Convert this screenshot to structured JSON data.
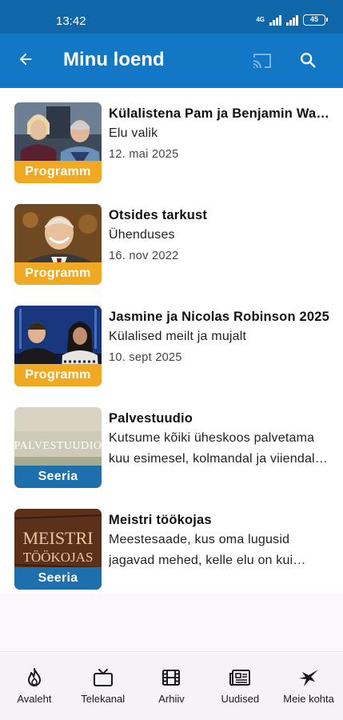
{
  "status_bar": {
    "time": "13:42",
    "network": "4G",
    "battery": "45"
  },
  "app_bar": {
    "title": "Minu loend"
  },
  "colors": {
    "app_bar": "#1277c4",
    "status_bar": "#0f66a8",
    "program_badge": "#f2a922",
    "series_badge": "#1d6fae"
  },
  "items": [
    {
      "badge": "Programm",
      "title": "Külalistena Pam ja Benjamin Wagner",
      "subtitle": "Elu valik",
      "date": "12. mai 2025"
    },
    {
      "badge": "Programm",
      "title": "Otsides tarkust",
      "subtitle": "Ühenduses",
      "date": "16. nov 2022"
    },
    {
      "badge": "Programm",
      "title": "Jasmine ja Nicolas Robinson 2025",
      "subtitle": "Külalised meilt ja mujalt",
      "date": "10. sept 2025"
    },
    {
      "badge": "Seeria",
      "title": "Palvestuudio",
      "description": "Kutsume kõiki üheskoos palvetama kuu esimesel, kolmandal ja viiendal teisipäeval",
      "thumb_text": "PALVESTUUDIO"
    },
    {
      "badge": "Seeria",
      "title": "Meistri töökojas",
      "description": "Meestesaade, kus oma lugusid jagavad mehed, kelle elu on kui meistri töökoda",
      "thumb_text_line1": "MEISTRI",
      "thumb_text_line2": "TÖÖKOJAS"
    }
  ],
  "bottom_nav": [
    {
      "label": "Avaleht",
      "icon": "flame-icon"
    },
    {
      "label": "Telekanal",
      "icon": "tv-icon"
    },
    {
      "label": "Arhiiv",
      "icon": "film-icon"
    },
    {
      "label": "Uudised",
      "icon": "newspaper-icon"
    },
    {
      "label": "Meie kohta",
      "icon": "bird-icon"
    }
  ]
}
